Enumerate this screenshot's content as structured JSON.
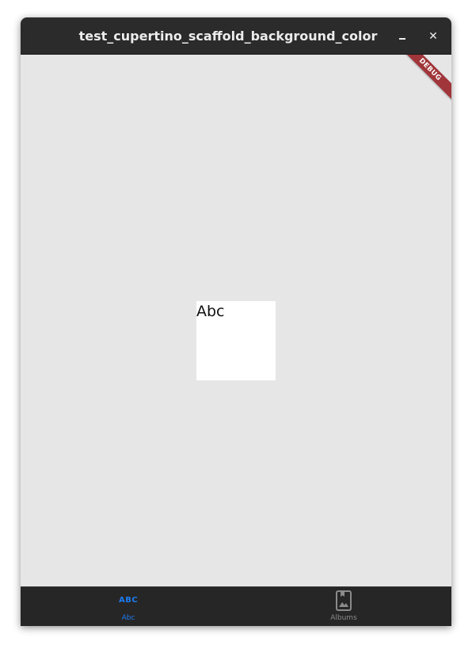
{
  "window": {
    "title": "test_cupertino_scaffold_background_color",
    "minimize_symbol": "–",
    "close_symbol": "✕"
  },
  "debug_banner": {
    "label": "DEBUG"
  },
  "content": {
    "box_text": "Abc",
    "background_color": "#e6e6e6",
    "box_color": "#ffffff"
  },
  "tabbar": {
    "active_color": "#1e7cf2",
    "inactive_color": "#8a8a8a",
    "tabs": [
      {
        "label": "Abc",
        "icon": "abc-icon",
        "icon_text": "ABC",
        "active": true
      },
      {
        "label": "Albums",
        "icon": "photo-album-icon",
        "active": false
      }
    ]
  }
}
